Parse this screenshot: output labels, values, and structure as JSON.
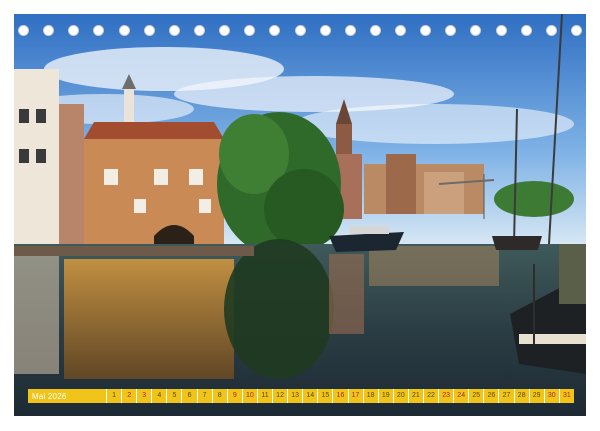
{
  "calendar": {
    "month_label": "Mai 2026",
    "days": [
      {
        "n": "1",
        "we": false
      },
      {
        "n": "2",
        "we": true
      },
      {
        "n": "3",
        "we": true
      },
      {
        "n": "4",
        "we": false
      },
      {
        "n": "5",
        "we": false
      },
      {
        "n": "6",
        "we": false
      },
      {
        "n": "7",
        "we": false
      },
      {
        "n": "8",
        "we": false
      },
      {
        "n": "9",
        "we": true
      },
      {
        "n": "10",
        "we": true
      },
      {
        "n": "11",
        "we": false
      },
      {
        "n": "12",
        "we": false
      },
      {
        "n": "13",
        "we": false
      },
      {
        "n": "14",
        "we": false
      },
      {
        "n": "15",
        "we": false
      },
      {
        "n": "16",
        "we": true
      },
      {
        "n": "17",
        "we": true
      },
      {
        "n": "18",
        "we": false
      },
      {
        "n": "19",
        "we": false
      },
      {
        "n": "20",
        "we": false
      },
      {
        "n": "21",
        "we": false
      },
      {
        "n": "22",
        "we": false
      },
      {
        "n": "23",
        "we": true
      },
      {
        "n": "24",
        "we": true
      },
      {
        "n": "25",
        "we": false
      },
      {
        "n": "26",
        "we": false
      },
      {
        "n": "27",
        "we": false
      },
      {
        "n": "28",
        "we": false
      },
      {
        "n": "29",
        "we": false
      },
      {
        "n": "30",
        "we": true
      },
      {
        "n": "31",
        "we": true
      }
    ],
    "binding_hole_count": 23
  },
  "colors": {
    "strip": "#f0c419",
    "weekend_text": "#b0242a",
    "weekday_text": "#5a4a00"
  }
}
